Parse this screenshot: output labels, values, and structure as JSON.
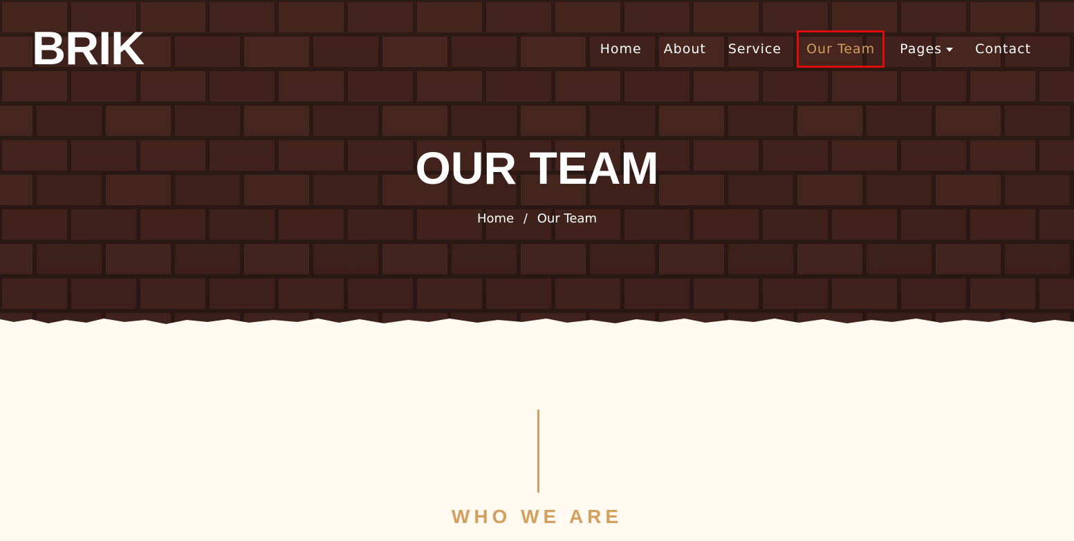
{
  "brand": {
    "logo_text": "BRIK"
  },
  "nav": {
    "items": [
      {
        "label": "Home"
      },
      {
        "label": "About"
      },
      {
        "label": "Service"
      },
      {
        "label": "Our Team"
      },
      {
        "label": "Pages"
      },
      {
        "label": "Contact"
      }
    ],
    "active_index": 3
  },
  "hero": {
    "title": "OUR TEAM",
    "breadcrumb": {
      "home": "Home",
      "separator": "/",
      "current": "Our Team"
    }
  },
  "section": {
    "subtitle": "WHO WE ARE"
  },
  "colors": {
    "accent": "#d39f5c",
    "page_bg": "#fff9f2",
    "brick": "#4a2720",
    "mortar": "#2f1b16",
    "highlight_box": "#e00b0b"
  },
  "icons": {
    "pages_dropdown": "caret-down-icon"
  }
}
